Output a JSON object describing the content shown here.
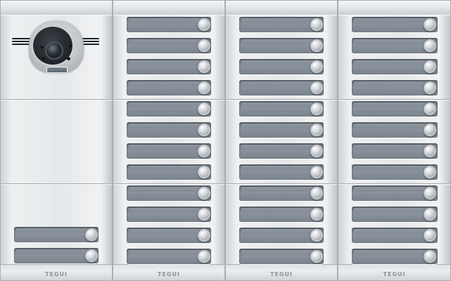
{
  "brand": {
    "name": "TEGUI"
  },
  "panel": {
    "columns": 4,
    "rows_per_module": 4,
    "modules_per_column": 3
  },
  "icons": {
    "camera": "camera-icon",
    "speaker": "speaker-grille-icon",
    "call_button": "push-button-icon"
  },
  "colors": {
    "panel": "#e3e6e8",
    "name_slot": "#7a838d",
    "button": "#d8dcdf"
  }
}
